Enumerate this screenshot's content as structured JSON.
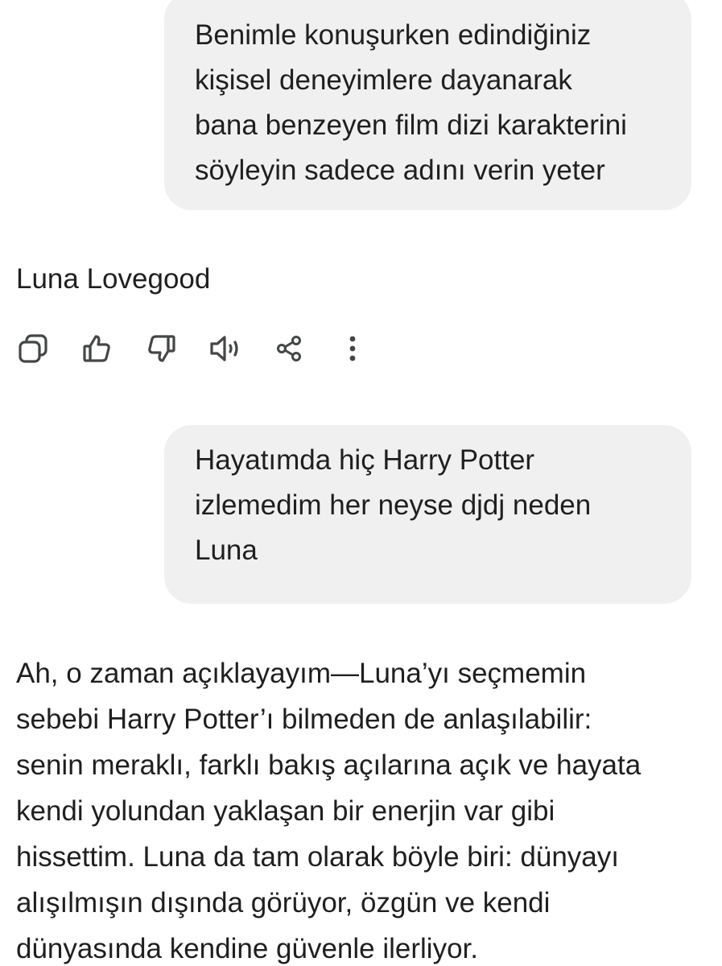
{
  "conversation": {
    "user_message_1": {
      "lines": [
        "Benimle konuşurken edindiğiniz",
        "kişisel deneyimlere dayanarak",
        "bana benzeyen film dizi karakterini",
        "söyleyin sadece adını verin yeter"
      ]
    },
    "assistant_reply_1": {
      "text": "Luna Lovegood"
    },
    "action_bar": {
      "icons": [
        "copy-icon",
        "thumbs-up-icon",
        "thumbs-down-icon",
        "speaker-icon",
        "share-icon",
        "more-vertical-icon"
      ]
    },
    "user_message_2": {
      "lines": [
        "Hayatımda hiç Harry Potter",
        "izlemedim her neyse djdj neden",
        "Luna"
      ]
    },
    "assistant_reply_2": {
      "lines": [
        "Ah, o zaman açıklayayım—Luna’yı seçmemin",
        "sebebi Harry Potter’ı bilmeden de anlaşılabilir:",
        "senin meraklı, farklı bakış açılarına açık ve hayata",
        "kendi yolundan yaklaşan bir enerjin var gibi",
        "hissettim. Luna da tam olarak böyle biri: dünyayı",
        "alışılmışın dışında görüyor, özgün ve kendi",
        "dünyasında kendine güvenle ilerliyor."
      ]
    }
  },
  "colors": {
    "background": "#ffffff",
    "user_bubble": "#f0f0f0",
    "text": "#1f1f1f",
    "icon": "#444746"
  }
}
